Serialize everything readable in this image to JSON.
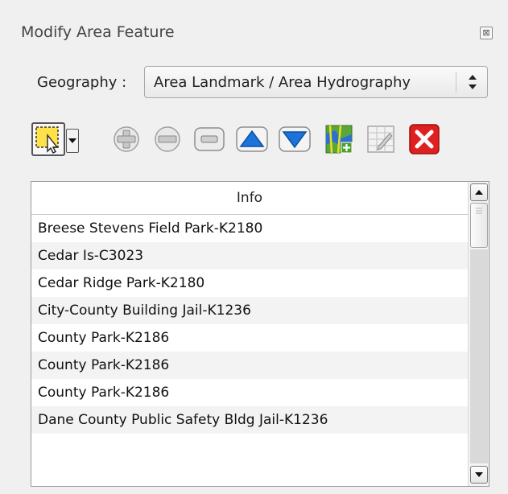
{
  "panel": {
    "title": "Modify Area Feature",
    "close_icon": "close-icon"
  },
  "geography": {
    "label": "Geography :",
    "selected": "Area Landmark / Area Hydrography"
  },
  "toolbar": {
    "icons": [
      "select-icon",
      "dropdown-arrow-icon",
      "add-icon",
      "remove-icon",
      "move-up-icon",
      "move-down-icon",
      "map-add-icon",
      "edit-table-icon",
      "delete-icon"
    ]
  },
  "table": {
    "header": "Info",
    "rows": [
      "Breese Stevens Field Park-K2180",
      "Cedar Is-C3023",
      "Cedar Ridge Park-K2180",
      "City-County Building Jail-K1236",
      "County Park-K2186",
      "County Park-K2186",
      "County Park-K2186",
      "Dane County Public Safety Bldg Jail-K1236"
    ]
  },
  "colors": {
    "accent_blue": "#1e73d9",
    "delete_red": "#e02020",
    "select_yellow": "#ffe24a"
  }
}
